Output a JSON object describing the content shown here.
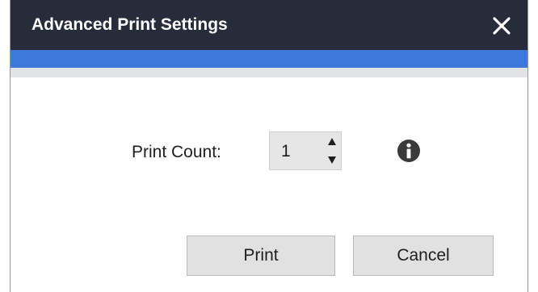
{
  "window": {
    "title": "Advanced Print Settings",
    "close_icon": "close-icon"
  },
  "colors": {
    "titlebar": "#262c3a",
    "accent": "#3c79d9",
    "subheader": "#e2e3e6",
    "button_bg": "#e1e1e1",
    "stepper_bg": "#e6e6e6",
    "info_icon": "#3a3a3a"
  },
  "form": {
    "print_count_label": "Print Count:",
    "print_count_value": "1",
    "up_arrow_icon": "triangle-up-icon",
    "down_arrow_icon": "triangle-down-icon",
    "info_icon": "info-icon"
  },
  "buttons": {
    "print_label": "Print",
    "cancel_label": "Cancel"
  }
}
